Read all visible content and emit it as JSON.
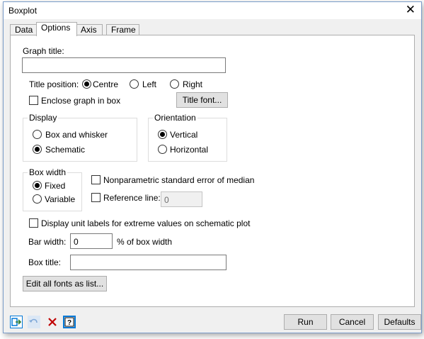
{
  "window": {
    "title": "Boxplot"
  },
  "tabs": [
    {
      "label": "Data"
    },
    {
      "label": "Options"
    },
    {
      "label": "Axis"
    },
    {
      "label": "Frame"
    }
  ],
  "options": {
    "graph_title_label": "Graph title:",
    "graph_title_value": "",
    "title_position_label": "Title position:",
    "title_position_options": [
      "Centre",
      "Left",
      "Right"
    ],
    "title_position_selected": "Centre",
    "enclose_label": "Enclose graph in box",
    "enclose_checked": false,
    "title_font_button": "Title font...",
    "display_group": {
      "label": "Display",
      "options": [
        "Box and whisker",
        "Schematic"
      ],
      "selected": "Schematic"
    },
    "orientation_group": {
      "label": "Orientation",
      "options": [
        "Vertical",
        "Horizontal"
      ],
      "selected": "Vertical"
    },
    "box_width_group": {
      "label": "Box width",
      "options": [
        "Fixed",
        "Variable"
      ],
      "selected": "Fixed"
    },
    "nonparametric_label": "Nonparametric standard error of median",
    "nonparametric_checked": false,
    "reference_line_label": "Reference line:",
    "reference_line_checked": false,
    "reference_line_value": "0",
    "unit_labels_label": "Display unit labels for extreme values on schematic plot",
    "unit_labels_checked": false,
    "bar_width_label": "Bar width:",
    "bar_width_value": "0",
    "bar_width_suffix": "% of box width",
    "box_title_label": "Box title:",
    "box_title_value": "",
    "edit_fonts_button": "Edit all fonts as list..."
  },
  "footer": {
    "run_button": "Run",
    "cancel_button": "Cancel",
    "defaults_button": "Defaults",
    "icons": [
      "exit-icon",
      "undo-icon",
      "clear-icon",
      "help-icon"
    ]
  },
  "colors": {
    "accent": "#0078d7",
    "clear_red": "#c00000",
    "window_border": "#7a9cc9"
  }
}
